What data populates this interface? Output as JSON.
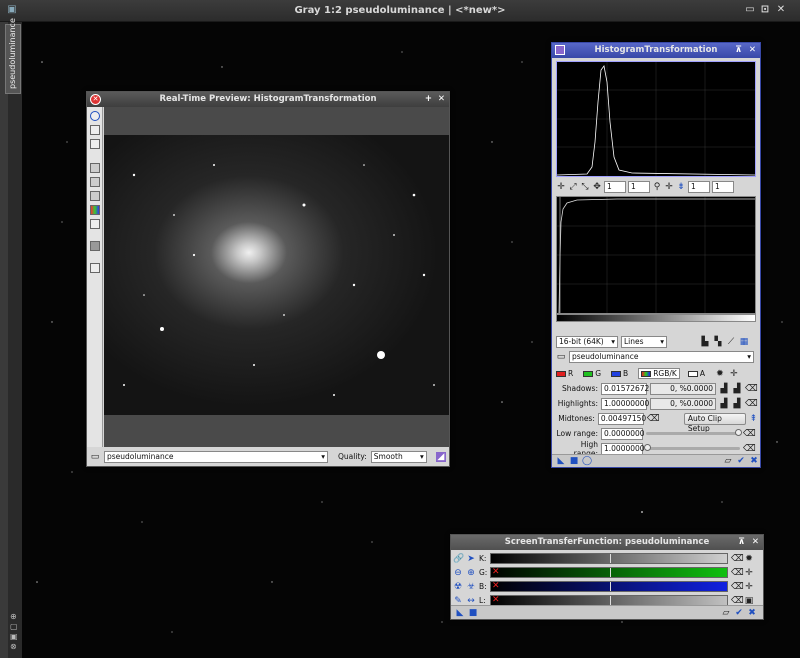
{
  "main_window": {
    "title": "Gray 1:2 pseudoluminance | <*new*>",
    "side_tab": "pseudoluminance",
    "controls": [
      "⊞",
      "▫",
      "✕"
    ]
  },
  "preview": {
    "title": "Real-Time Preview: HistogramTransformation",
    "view_selected": "pseudoluminance",
    "quality_label": "Quality:",
    "quality_value": "Smooth"
  },
  "histogram": {
    "title": "HistogramTransformation",
    "zoom_h": "1",
    "zoom_v": "1",
    "zoom_h2": "1",
    "zoom_v2": "1",
    "resolution": "16-bit (64K)",
    "graph_style": "Lines",
    "view_selected": "pseudoluminance",
    "channels": [
      {
        "label": "R",
        "color": "#e02020"
      },
      {
        "label": "G",
        "color": "#20c020"
      },
      {
        "label": "B",
        "color": "#2040e0"
      },
      {
        "label": "RGB/K",
        "color": "#333333"
      },
      {
        "label": "A",
        "color": "#ffffff"
      }
    ],
    "shadows_label": "Shadows:",
    "shadows_value": "0.01572672",
    "shadows_clip": "0, %0.0000",
    "highlights_label": "Highlights:",
    "highlights_value": "1.00000000",
    "highlights_clip": "0, %0.0000",
    "midtones_label": "Midtones:",
    "midtones_value": "0.00497150",
    "auto_clip": "Auto Clip Setup",
    "low_range_label": "Low range:",
    "low_range_value": "0.0000000",
    "high_range_label": "High range:",
    "high_range_value": "1.0000000"
  },
  "stf": {
    "title": "ScreenTransferFunction: pseudoluminance",
    "channels": [
      {
        "label": "K:",
        "color": "#d0d0d0"
      },
      {
        "label": "G:",
        "color": "#10c010"
      },
      {
        "label": "B:",
        "color": "#1020e0"
      },
      {
        "label": "L:",
        "color": "#c0c0c0"
      }
    ]
  }
}
